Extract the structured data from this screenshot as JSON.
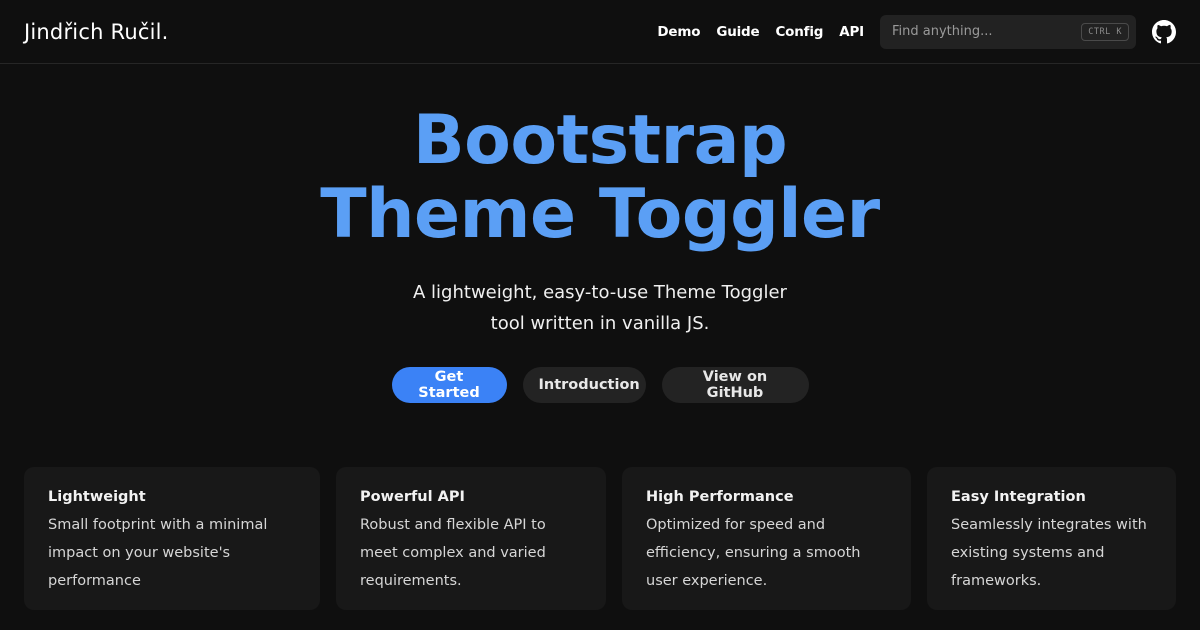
{
  "navbar": {
    "brand": "Jindřich Ručil.",
    "links": [
      {
        "label": "Demo"
      },
      {
        "label": "Guide"
      },
      {
        "label": "Config"
      },
      {
        "label": "API"
      }
    ],
    "search": {
      "placeholder": "Find anything...",
      "shortcut": "CTRL K"
    },
    "github_icon": "github-icon"
  },
  "hero": {
    "title_line1": "Bootstrap",
    "title_line2": "Theme Toggler",
    "subtitle_line1": "A lightweight, easy-to-use Theme Toggler",
    "subtitle_line2": "tool written in vanilla JS.",
    "buttons": {
      "get_started": "Get Started",
      "introduction": "Introduction",
      "github": "View on GitHub"
    }
  },
  "features": [
    {
      "title": "Lightweight",
      "description": "Small footprint with a minimal impact on your website's performance"
    },
    {
      "title": "Powerful API",
      "description": "Robust and flexible API to meet complex and varied requirements."
    },
    {
      "title": "High Performance",
      "description": "Optimized for speed and efficiency, ensuring a smooth user experience."
    },
    {
      "title": "Easy Integration",
      "description": "Seamlessly integrates with existing systems and frameworks."
    }
  ],
  "colors": {
    "background": "#0f0f0f",
    "accent": "#5b9ff5",
    "primary_button": "#3b82f6",
    "card": "#181818"
  }
}
